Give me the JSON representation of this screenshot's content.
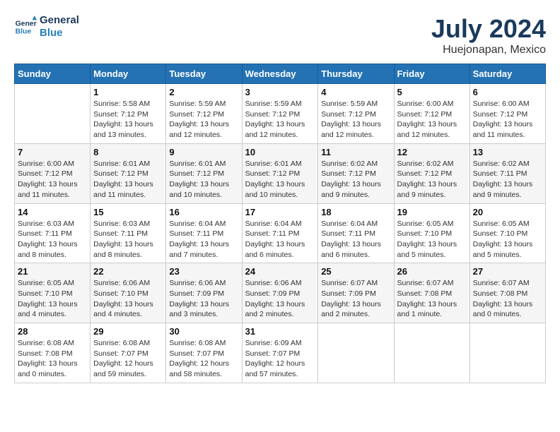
{
  "header": {
    "logo_line1": "General",
    "logo_line2": "Blue",
    "month": "July 2024",
    "location": "Huejonapan, Mexico"
  },
  "weekdays": [
    "Sunday",
    "Monday",
    "Tuesday",
    "Wednesday",
    "Thursday",
    "Friday",
    "Saturday"
  ],
  "weeks": [
    [
      {
        "day": "",
        "info": ""
      },
      {
        "day": "1",
        "info": "Sunrise: 5:58 AM\nSunset: 7:12 PM\nDaylight: 13 hours\nand 13 minutes."
      },
      {
        "day": "2",
        "info": "Sunrise: 5:59 AM\nSunset: 7:12 PM\nDaylight: 13 hours\nand 12 minutes."
      },
      {
        "day": "3",
        "info": "Sunrise: 5:59 AM\nSunset: 7:12 PM\nDaylight: 13 hours\nand 12 minutes."
      },
      {
        "day": "4",
        "info": "Sunrise: 5:59 AM\nSunset: 7:12 PM\nDaylight: 13 hours\nand 12 minutes."
      },
      {
        "day": "5",
        "info": "Sunrise: 6:00 AM\nSunset: 7:12 PM\nDaylight: 13 hours\nand 12 minutes."
      },
      {
        "day": "6",
        "info": "Sunrise: 6:00 AM\nSunset: 7:12 PM\nDaylight: 13 hours\nand 11 minutes."
      }
    ],
    [
      {
        "day": "7",
        "info": "Sunrise: 6:00 AM\nSunset: 7:12 PM\nDaylight: 13 hours\nand 11 minutes."
      },
      {
        "day": "8",
        "info": "Sunrise: 6:01 AM\nSunset: 7:12 PM\nDaylight: 13 hours\nand 11 minutes."
      },
      {
        "day": "9",
        "info": "Sunrise: 6:01 AM\nSunset: 7:12 PM\nDaylight: 13 hours\nand 10 minutes."
      },
      {
        "day": "10",
        "info": "Sunrise: 6:01 AM\nSunset: 7:12 PM\nDaylight: 13 hours\nand 10 minutes."
      },
      {
        "day": "11",
        "info": "Sunrise: 6:02 AM\nSunset: 7:12 PM\nDaylight: 13 hours\nand 9 minutes."
      },
      {
        "day": "12",
        "info": "Sunrise: 6:02 AM\nSunset: 7:12 PM\nDaylight: 13 hours\nand 9 minutes."
      },
      {
        "day": "13",
        "info": "Sunrise: 6:02 AM\nSunset: 7:11 PM\nDaylight: 13 hours\nand 9 minutes."
      }
    ],
    [
      {
        "day": "14",
        "info": "Sunrise: 6:03 AM\nSunset: 7:11 PM\nDaylight: 13 hours\nand 8 minutes."
      },
      {
        "day": "15",
        "info": "Sunrise: 6:03 AM\nSunset: 7:11 PM\nDaylight: 13 hours\nand 8 minutes."
      },
      {
        "day": "16",
        "info": "Sunrise: 6:04 AM\nSunset: 7:11 PM\nDaylight: 13 hours\nand 7 minutes."
      },
      {
        "day": "17",
        "info": "Sunrise: 6:04 AM\nSunset: 7:11 PM\nDaylight: 13 hours\nand 6 minutes."
      },
      {
        "day": "18",
        "info": "Sunrise: 6:04 AM\nSunset: 7:11 PM\nDaylight: 13 hours\nand 6 minutes."
      },
      {
        "day": "19",
        "info": "Sunrise: 6:05 AM\nSunset: 7:10 PM\nDaylight: 13 hours\nand 5 minutes."
      },
      {
        "day": "20",
        "info": "Sunrise: 6:05 AM\nSunset: 7:10 PM\nDaylight: 13 hours\nand 5 minutes."
      }
    ],
    [
      {
        "day": "21",
        "info": "Sunrise: 6:05 AM\nSunset: 7:10 PM\nDaylight: 13 hours\nand 4 minutes."
      },
      {
        "day": "22",
        "info": "Sunrise: 6:06 AM\nSunset: 7:10 PM\nDaylight: 13 hours\nand 4 minutes."
      },
      {
        "day": "23",
        "info": "Sunrise: 6:06 AM\nSunset: 7:09 PM\nDaylight: 13 hours\nand 3 minutes."
      },
      {
        "day": "24",
        "info": "Sunrise: 6:06 AM\nSunset: 7:09 PM\nDaylight: 13 hours\nand 2 minutes."
      },
      {
        "day": "25",
        "info": "Sunrise: 6:07 AM\nSunset: 7:09 PM\nDaylight: 13 hours\nand 2 minutes."
      },
      {
        "day": "26",
        "info": "Sunrise: 6:07 AM\nSunset: 7:08 PM\nDaylight: 13 hours\nand 1 minute."
      },
      {
        "day": "27",
        "info": "Sunrise: 6:07 AM\nSunset: 7:08 PM\nDaylight: 13 hours\nand 0 minutes."
      }
    ],
    [
      {
        "day": "28",
        "info": "Sunrise: 6:08 AM\nSunset: 7:08 PM\nDaylight: 13 hours\nand 0 minutes."
      },
      {
        "day": "29",
        "info": "Sunrise: 6:08 AM\nSunset: 7:07 PM\nDaylight: 12 hours\nand 59 minutes."
      },
      {
        "day": "30",
        "info": "Sunrise: 6:08 AM\nSunset: 7:07 PM\nDaylight: 12 hours\nand 58 minutes."
      },
      {
        "day": "31",
        "info": "Sunrise: 6:09 AM\nSunset: 7:07 PM\nDaylight: 12 hours\nand 57 minutes."
      },
      {
        "day": "",
        "info": ""
      },
      {
        "day": "",
        "info": ""
      },
      {
        "day": "",
        "info": ""
      }
    ]
  ]
}
